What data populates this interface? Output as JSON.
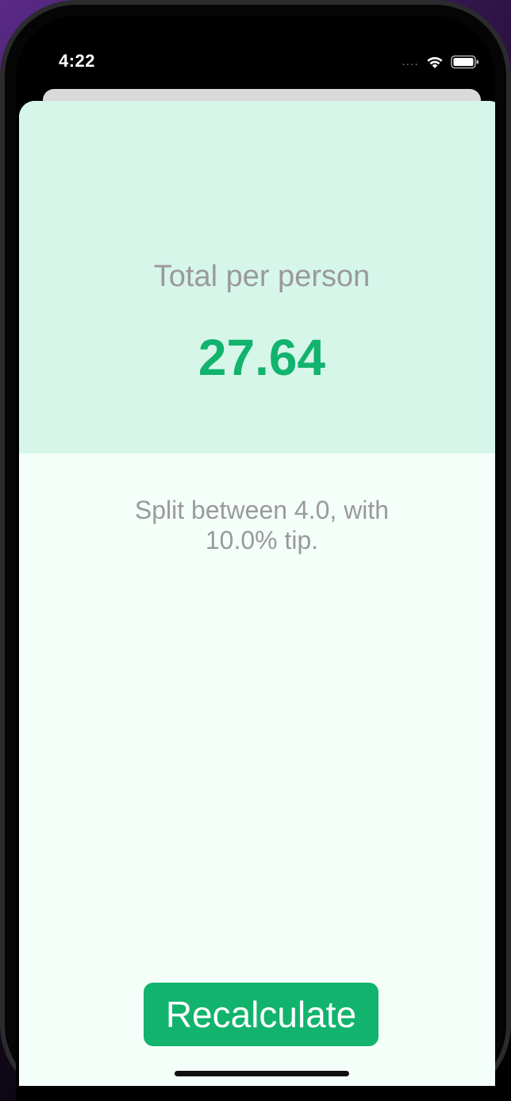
{
  "status_bar": {
    "time": "4:22",
    "signal": "....",
    "wifi_icon": "wifi-icon",
    "battery_icon": "battery-icon"
  },
  "result": {
    "title": "Total per person",
    "amount": "27.64",
    "settings": "Split between 4.0, with 10.0% tip."
  },
  "actions": {
    "recalculate_label": "Recalculate"
  },
  "colors": {
    "accent": "#12b36d",
    "top_panel": "#d6f6ea",
    "background": "#f5fff9",
    "secondary_text": "#9a9a9a"
  }
}
